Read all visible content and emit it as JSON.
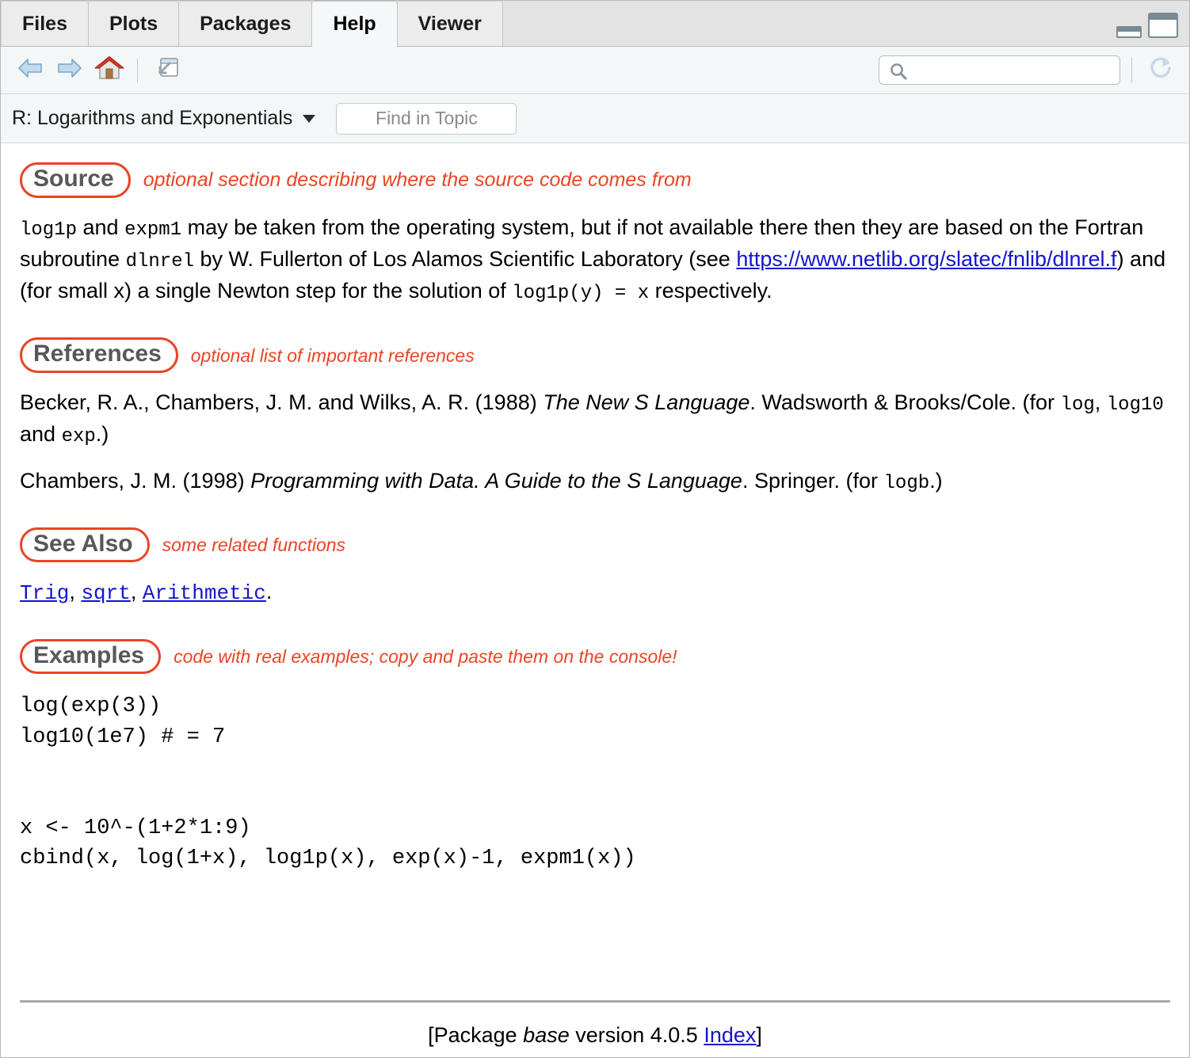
{
  "window": {
    "tabs": [
      {
        "label": "Files",
        "active": false
      },
      {
        "label": "Plots",
        "active": false
      },
      {
        "label": "Packages",
        "active": false
      },
      {
        "label": "Help",
        "active": true
      },
      {
        "label": "Viewer",
        "active": false
      }
    ],
    "pane_controls": {
      "minimize": "minimize-pane",
      "maximize": "maximize-pane"
    }
  },
  "toolbar": {
    "back": "back-arrow",
    "forward": "forward-arrow",
    "home": "home",
    "popout": "show-in-new-window",
    "refresh": "refresh",
    "search": {
      "value": "",
      "placeholder": ""
    }
  },
  "topicbar": {
    "topic": "R: Logarithms and Exponentials",
    "find": {
      "value": "",
      "placeholder": "Find in Topic"
    }
  },
  "colors": {
    "annotation_red": "#ea4426",
    "heading_gray": "#585858",
    "link_blue": "#1414cc",
    "active_tab_bg": "#f4f8f9",
    "toolbar_bg": "#f3f7f8"
  },
  "sections": [
    {
      "heading": "Source",
      "annotation": "optional section describing where the source code comes from"
    },
    {
      "heading": "References",
      "annotation": "optional list of important references"
    },
    {
      "heading": "See Also",
      "annotation": "some related functions"
    },
    {
      "heading": "Examples",
      "annotation": "code with real examples; copy and paste them on the console!"
    }
  ],
  "source": {
    "t1": "log1p",
    "t2": " and ",
    "t3": "expm1",
    "t4": " may be taken from the operating system, but if not available there then they are based on the Fortran subroutine ",
    "t5": "dlnrel",
    "t6": " by W. Fullerton of Los Alamos Scientific Laboratory (see ",
    "link": "https://www.netlib.org/slatec/fnlib/dlnrel.f",
    "t7": ") and (for small x) a single Newton step for the solution of ",
    "t8": "log1p(y) = x",
    "t9": " respectively."
  },
  "references": {
    "ref1": {
      "authors": "Becker, R. A., Chambers, J. M. and Wilks, A. R. (1988) ",
      "title": "The New S Language",
      "publisher": ". Wadsworth & Brooks/Cole. (for ",
      "code1": "log",
      "sep1": ", ",
      "code2": "log10",
      "sep2": " and ",
      "code3": "exp",
      "tail": ".)"
    },
    "ref2": {
      "authors": "Chambers, J. M. (1998) ",
      "title": "Programming with Data. A Guide to the S Language",
      "publisher": ". Springer. (for ",
      "code1": "logb",
      "tail": ".)"
    }
  },
  "see_also": {
    "links": [
      "Trig",
      "sqrt",
      "Arithmetic"
    ],
    "sep": ", ",
    "period": "."
  },
  "examples": {
    "code": "log(exp(3))\nlog10(1e7) # = 7\n\n\nx <- 10^-(1+2*1:9)\ncbind(x, log(1+x), log1p(x), exp(x)-1, expm1(x))"
  },
  "footer": {
    "open_bracket": "[Package ",
    "package": "base",
    "version_text": " version 4.0.5 ",
    "index_link": "Index",
    "close_bracket": "]"
  }
}
